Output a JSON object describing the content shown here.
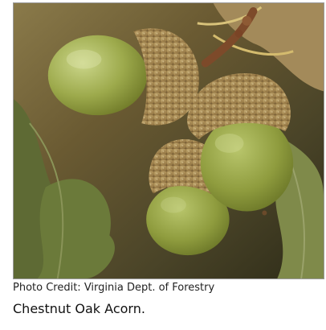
{
  "photo": {
    "credit": "Photo Credit: Virginia Dept. of Forestry",
    "caption": "Chestnut Oak Acorn.",
    "colors": {
      "background_dark": "#3c3a22",
      "background_mid": "#7a6a3e",
      "leaf_green": "#6f7a3c",
      "acorn_light": "#b6c36a",
      "acorn_dark": "#7e8b32",
      "cap_light": "#c6ad72",
      "cap_dark": "#8c7040",
      "stem": "#7d4a2a"
    }
  }
}
